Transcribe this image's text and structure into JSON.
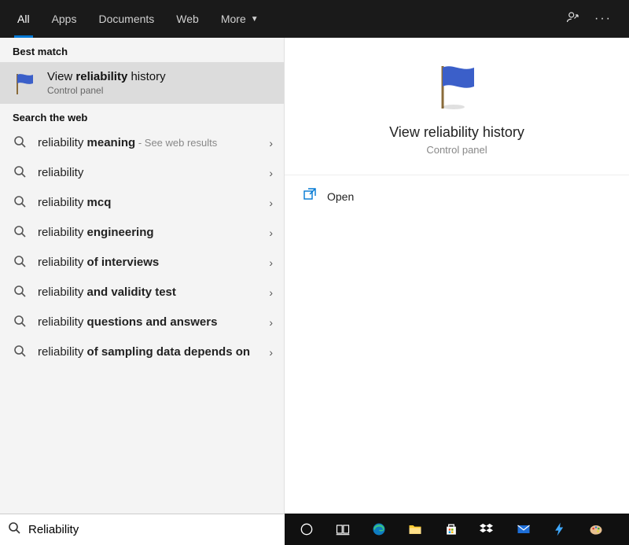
{
  "tabs": {
    "items": [
      {
        "label": "All",
        "active": true
      },
      {
        "label": "Apps",
        "active": false
      },
      {
        "label": "Documents",
        "active": false
      },
      {
        "label": "Web",
        "active": false
      },
      {
        "label": "More",
        "active": false,
        "dropdown": true
      }
    ]
  },
  "left": {
    "best_match_header": "Best match",
    "best_match": {
      "title_pre": "View ",
      "title_bold": "reliability",
      "title_post": " history",
      "subtitle": "Control panel"
    },
    "web_header": "Search the web",
    "web_items": [
      {
        "pre": "reliability ",
        "bold": "meaning",
        "post": "",
        "hint": " - See web results"
      },
      {
        "pre": "reliability",
        "bold": "",
        "post": "",
        "hint": ""
      },
      {
        "pre": "reliability ",
        "bold": "mcq",
        "post": "",
        "hint": ""
      },
      {
        "pre": "reliability ",
        "bold": "engineering",
        "post": "",
        "hint": ""
      },
      {
        "pre": "reliability ",
        "bold": "of interviews",
        "post": "",
        "hint": ""
      },
      {
        "pre": "reliability ",
        "bold": "and validity test",
        "post": "",
        "hint": ""
      },
      {
        "pre": "reliability ",
        "bold": "questions and answers",
        "post": "",
        "hint": ""
      },
      {
        "pre": "reliability ",
        "bold": "of sampling data depends on",
        "post": "",
        "hint": ""
      }
    ]
  },
  "right": {
    "title": "View reliability history",
    "subtitle": "Control panel",
    "open_label": "Open"
  },
  "search": {
    "value": "Reliability"
  },
  "taskbar_icons": [
    "cortana-icon",
    "task-view-icon",
    "edge-icon",
    "file-explorer-icon",
    "store-icon",
    "dropbox-icon",
    "mail-icon",
    "lightning-icon",
    "paint-icon"
  ]
}
